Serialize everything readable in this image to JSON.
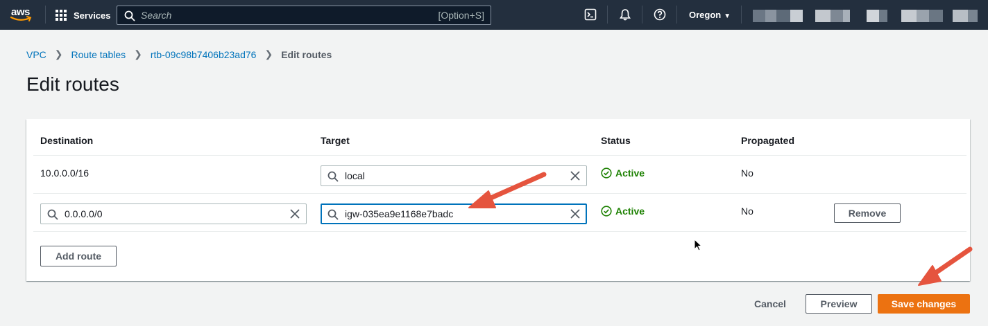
{
  "colors": {
    "nav_bg": "#232f3e",
    "link": "#0073bb",
    "primary": "#ec7211",
    "status_active": "#1d8102",
    "annotation_arrow": "#e5543e"
  },
  "nav": {
    "logo_text": "aws",
    "services_label": "Services",
    "search_placeholder": "Search",
    "search_shortcut": "[Option+S]",
    "region_label": "Oregon",
    "icons": [
      "cloudshell-icon",
      "bell-icon",
      "help-icon",
      "caret-down-icon"
    ]
  },
  "breadcrumb": {
    "items": [
      "VPC",
      "Route tables",
      "rtb-09c98b7406b23ad76"
    ],
    "current": "Edit routes"
  },
  "page": {
    "title": "Edit routes"
  },
  "routes_table": {
    "columns": [
      "Destination",
      "Target",
      "Status",
      "Propagated"
    ],
    "rows": [
      {
        "destination": "10.0.0.0/16",
        "target": "local",
        "status": "Active",
        "propagated": "No"
      },
      {
        "destination": "0.0.0.0/0",
        "target": "igw-035ea9e1168e7badc",
        "status": "Active",
        "propagated": "No",
        "remove_label": "Remove"
      }
    ],
    "add_route_label": "Add route"
  },
  "footer": {
    "cancel_label": "Cancel",
    "preview_label": "Preview",
    "save_label": "Save changes"
  }
}
